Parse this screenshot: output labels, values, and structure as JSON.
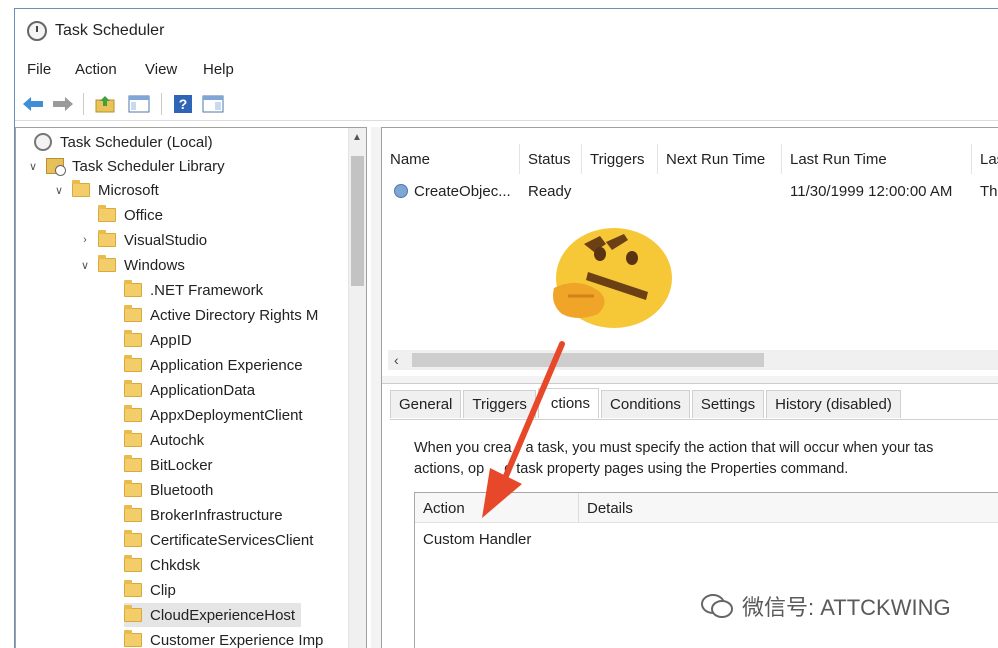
{
  "window": {
    "title": "Task Scheduler"
  },
  "menu": [
    "File",
    "Action",
    "View",
    "Help"
  ],
  "toolbar": {
    "icons": [
      "back-arrow-icon",
      "forward-arrow-icon",
      "folder-up-icon",
      "show-hide-console-tree-icon",
      "help-icon",
      "show-hide-action-pane-icon"
    ]
  },
  "tree": {
    "items": [
      {
        "label": "Task Scheduler (Local)",
        "icon": "clock-icon"
      },
      {
        "label": "Task Scheduler Library",
        "icon": "library-icon",
        "expanded": true
      },
      {
        "label": "Microsoft",
        "icon": "folder-icon",
        "expanded": true
      },
      {
        "label": "Office",
        "icon": "folder-icon"
      },
      {
        "label": "VisualStudio",
        "icon": "folder-icon",
        "collapsed": true
      },
      {
        "label": "Windows",
        "icon": "folder-icon",
        "expanded": true
      },
      {
        "label": ".NET Framework",
        "icon": "folder-icon"
      },
      {
        "label": "Active Directory Rights M",
        "icon": "folder-icon"
      },
      {
        "label": "AppID",
        "icon": "folder-icon"
      },
      {
        "label": "Application Experience",
        "icon": "folder-icon"
      },
      {
        "label": "ApplicationData",
        "icon": "folder-icon"
      },
      {
        "label": "AppxDeploymentClient",
        "icon": "folder-icon"
      },
      {
        "label": "Autochk",
        "icon": "folder-icon"
      },
      {
        "label": "BitLocker",
        "icon": "folder-icon"
      },
      {
        "label": "Bluetooth",
        "icon": "folder-icon"
      },
      {
        "label": "BrokerInfrastructure",
        "icon": "folder-icon"
      },
      {
        "label": "CertificateServicesClient",
        "icon": "folder-icon"
      },
      {
        "label": "Chkdsk",
        "icon": "folder-icon"
      },
      {
        "label": "Clip",
        "icon": "folder-icon"
      },
      {
        "label": "CloudExperienceHost",
        "icon": "folder-icon",
        "selected": true
      },
      {
        "label": "Customer Experience Imp",
        "icon": "folder-icon"
      }
    ]
  },
  "task_list": {
    "columns": [
      "Name",
      "Status",
      "Triggers",
      "Next Run Time",
      "Last Run Time",
      "Las"
    ],
    "rows": [
      {
        "name": "CreateObjec...",
        "status": "Ready",
        "triggers": "",
        "next_run": "",
        "last_run": "11/30/1999 12:00:00 AM",
        "last_result": "The"
      }
    ]
  },
  "details": {
    "tabs": [
      "General",
      "Triggers",
      "Actions",
      "Conditions",
      "Settings",
      "History (disabled)"
    ],
    "active_tab": "Actions",
    "tab_label_shown": "ctions",
    "description_line1": "When you crea",
    "description_line1b": "a task, you must specify the action that will occur when your tas",
    "description_line2": "actions, op",
    "description_line2b": "e task property pages using the Properties command.",
    "actions_table": {
      "columns": [
        "Action",
        "Details"
      ],
      "rows": [
        {
          "action": "Custom Handler",
          "details": ""
        }
      ]
    }
  },
  "watermark": {
    "text": "微信号: ATTCKWING"
  },
  "colors": {
    "selection": "#e5e5e5",
    "arrow": "#e8482a",
    "folder": "#f2cd6a",
    "emoji": "#f6c737"
  }
}
